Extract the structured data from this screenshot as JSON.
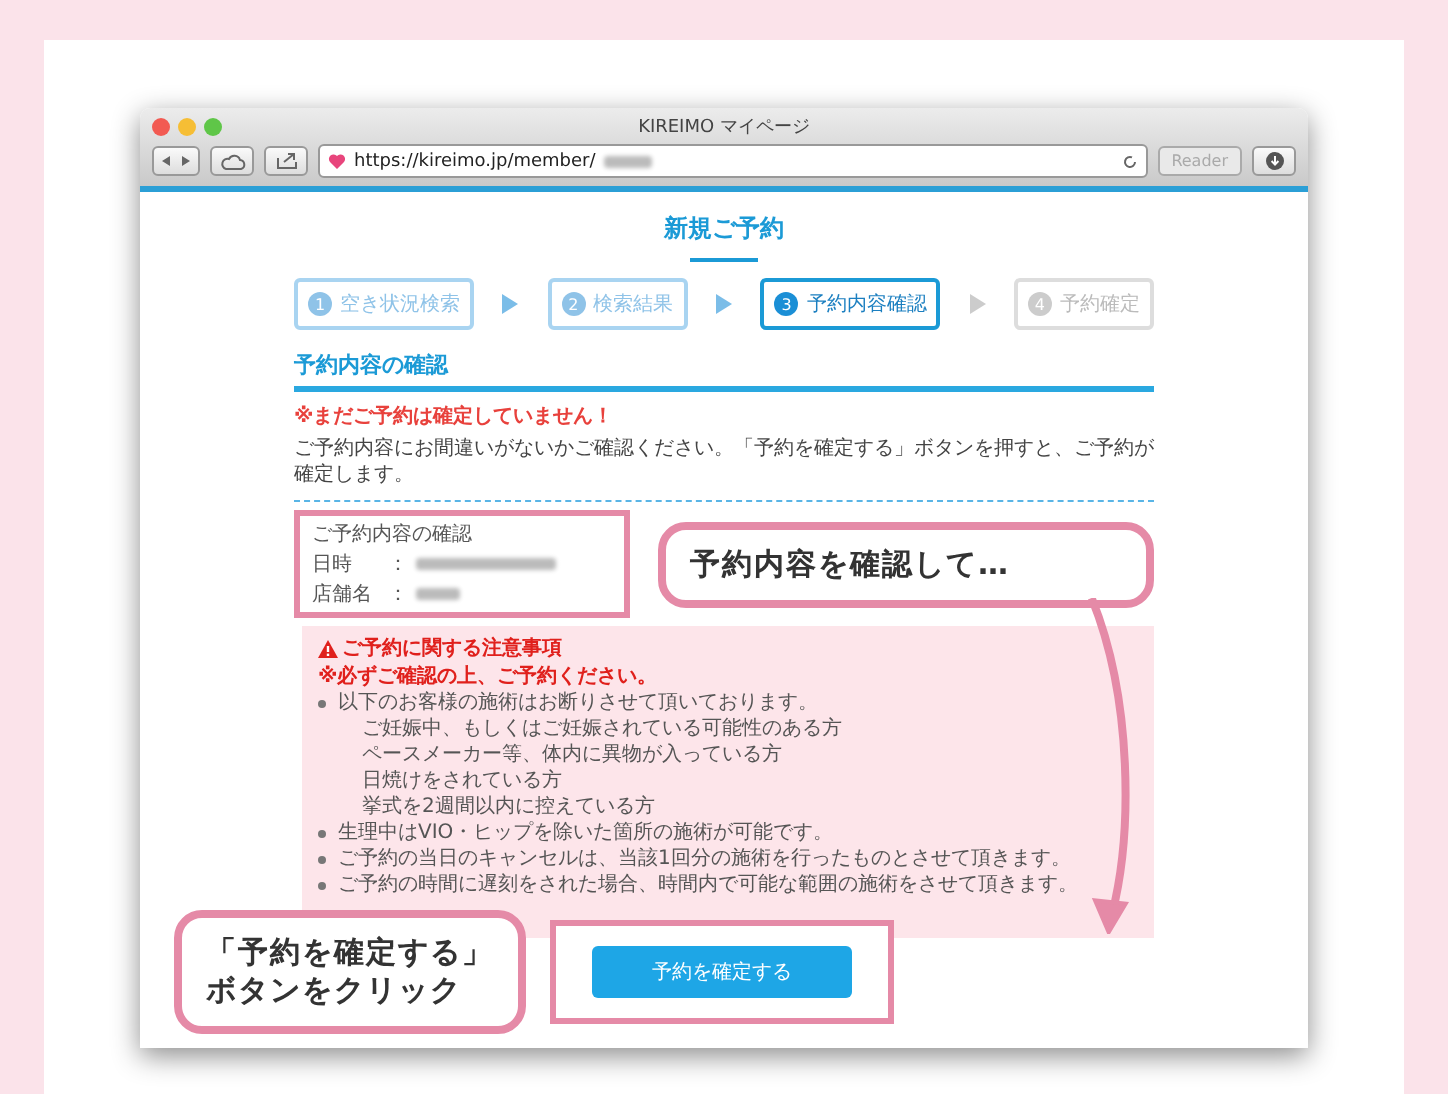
{
  "window": {
    "title": "KIREIMO マイページ",
    "url": "https://kireimo.jp/member/",
    "reader_label": "Reader"
  },
  "page": {
    "heading": "新規ご予約",
    "steps": [
      {
        "number": "1",
        "label": "空き状況検索",
        "selected": false,
        "done": true
      },
      {
        "number": "2",
        "label": "検索結果",
        "selected": false,
        "done": true
      },
      {
        "number": "3",
        "label": "予約内容確認",
        "selected": true,
        "done": false
      },
      {
        "number": "4",
        "label": "予約確定",
        "selected": false,
        "done": false
      }
    ],
    "section_title": "予約内容の確認",
    "warning": "※まだご予約は確定していません！",
    "instructions": "ご予約内容にお間違いがないかご確認ください。「予約を確定する」ボタンを押すと、ご予約が確定します。",
    "summary": {
      "title": "ご予約内容の確認",
      "rows": [
        {
          "label": "日時",
          "separator": "："
        },
        {
          "label": "店舗名",
          "separator": "："
        }
      ]
    },
    "notice": {
      "title": "ご予約に関する注意事項",
      "subtitle": "※必ずご確認の上、ご予約ください。",
      "items": [
        {
          "text": "以下のお客様の施術はお断りさせて頂いております。",
          "children": [
            {
              "text": "ご妊娠中、もしくはご妊娠されている可能性のある方"
            },
            {
              "text": "ペースメーカー等、体内に異物が入っている方"
            },
            {
              "text": "日焼けをされている方"
            },
            {
              "text": "挙式を2週間以内に控えている方"
            }
          ]
        },
        {
          "text": "生理中はVIO・ヒップを除いた箇所の施術が可能です。"
        },
        {
          "text": "ご予約の当日のキャンセルは、当該1回分の施術を行ったものとさせて頂きます。"
        },
        {
          "text": "ご予約の時間に遅刻をされた場合、時間内で可能な範囲の施術をさせて頂きます。"
        }
      ]
    },
    "confirm_button": "予約を確定する"
  },
  "annotations": [
    {
      "lines": [
        "予約内容を確認して…"
      ]
    },
    {
      "lines": [
        "「予約を確定する」",
        "ボタンをクリック"
      ]
    }
  ]
}
